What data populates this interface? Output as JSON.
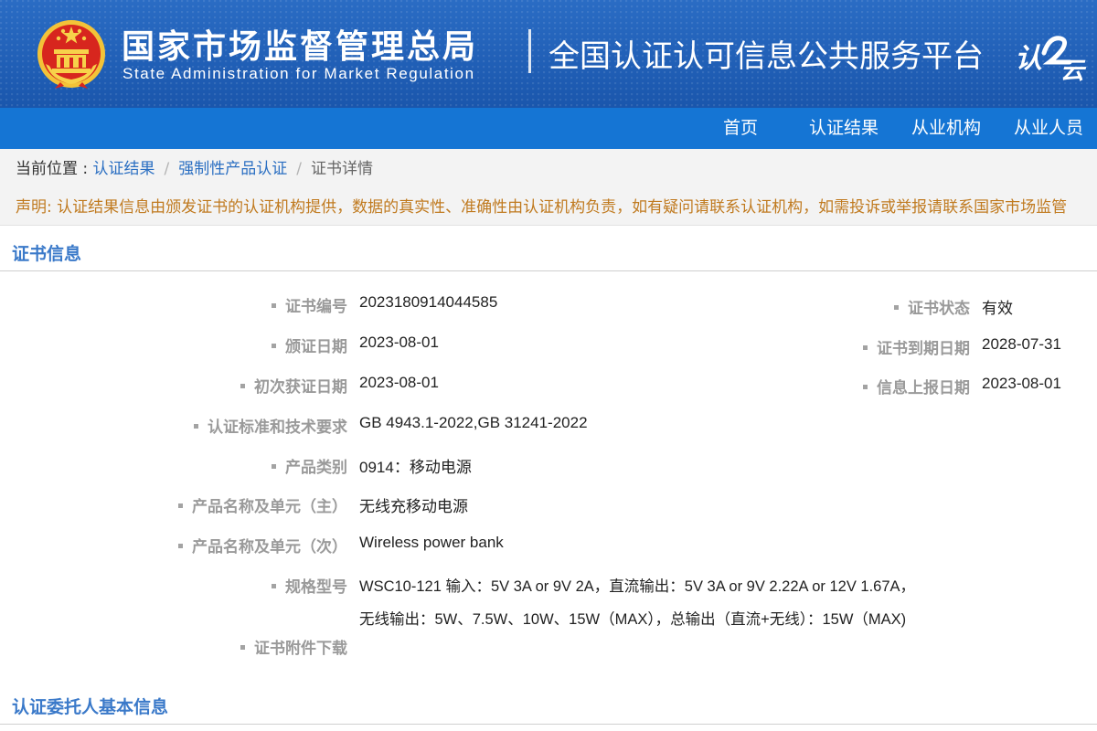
{
  "header": {
    "agency_cn": "国家市场监督管理总局",
    "agency_en": "State Administration  for  Market Regulation",
    "platform": "全国认证认可信息公共服务平台",
    "logo_text": "认云",
    "brand_color": "#1d5db5"
  },
  "nav": {
    "items": [
      {
        "label": "首页"
      },
      {
        "label": "认证结果"
      },
      {
        "label": "从业机构"
      },
      {
        "label": "从业人员"
      }
    ],
    "bg_color": "#1575d4"
  },
  "breadcrumb": {
    "prefix": "当前位置 : ",
    "items": [
      {
        "label": "认证结果"
      },
      {
        "label": "强制性产品认证"
      },
      {
        "label": "证书详情"
      }
    ],
    "separator": "/"
  },
  "notice": "声明: 认证结果信息由颁发证书的认证机构提供，数据的真实性、准确性由认证机构负责，如有疑问请联系认证机构，如需投诉或举报请联系国家市场监管",
  "certificate_section": {
    "title": "证书信息",
    "fields": {
      "cert_no": {
        "label": "证书编号",
        "value": "2023180914044585"
      },
      "status": {
        "label": "证书状态",
        "value": "有效"
      },
      "issue_date": {
        "label": "颁证日期",
        "value": "2023-08-01"
      },
      "expiry_date": {
        "label": "证书到期日期",
        "value": "2028-07-31"
      },
      "first_date": {
        "label": "初次获证日期",
        "value": "2023-08-01"
      },
      "report_date": {
        "label": "信息上报日期",
        "value": "2023-08-01"
      },
      "standards": {
        "label": "认证标准和技术要求",
        "value": "GB 4943.1-2022,GB 31241-2022"
      },
      "category": {
        "label": "产品类别",
        "value": "0914：移动电源"
      },
      "product_main": {
        "label": "产品名称及单元（主）",
        "value": "无线充移动电源"
      },
      "product_sub": {
        "label": "产品名称及单元（次）",
        "value": "Wireless power bank"
      },
      "model": {
        "label": "规格型号",
        "value_line1": "WSC10-121 输入：5V 3A or 9V 2A，直流输出：5V 3A or 9V 2.22A or 12V 1.67A，",
        "value_line2": "无线输出：5W、7.5W、10W、15W（MAX），总输出（直流+无线）：15W（MAX)"
      },
      "attachment": {
        "label": "证书附件下载"
      }
    }
  },
  "client_section": {
    "title": "认证委托人基本信息"
  }
}
